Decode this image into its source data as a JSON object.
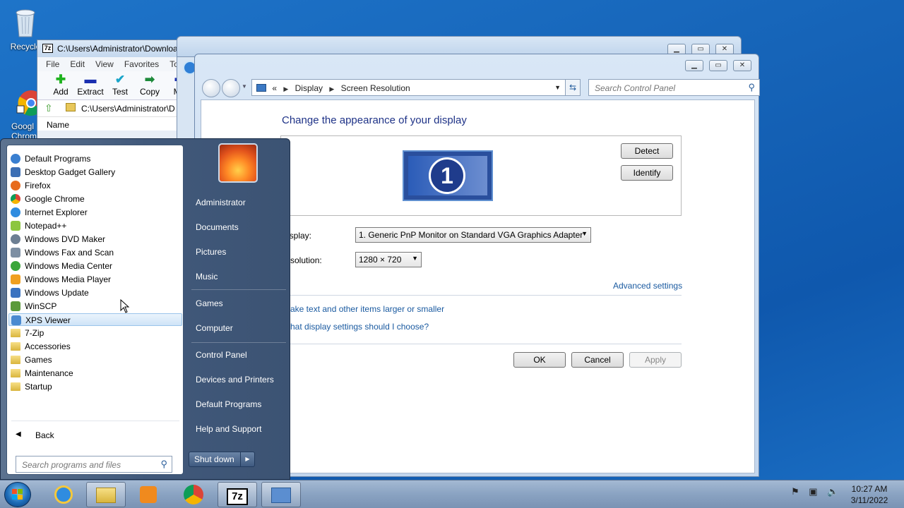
{
  "desktop": {
    "icons": [
      {
        "label": "Recycle"
      },
      {
        "label": "Googl\nChrom"
      }
    ]
  },
  "sevenzip": {
    "title": "C:\\Users\\Administrator\\Downloa",
    "menu": [
      "File",
      "Edit",
      "View",
      "Favorites",
      "Too"
    ],
    "toolbar": [
      "Add",
      "Extract",
      "Test",
      "Copy",
      "Mo"
    ],
    "address": "C:\\Users\\Administrator\\D",
    "column_header": "Name"
  },
  "control_panel": {
    "breadcrumb": {
      "root_sep": "«",
      "crumb1": "Display",
      "crumb2": "Screen Resolution"
    },
    "search_placeholder": "Search Control Panel",
    "heading": "Change the appearance of your display",
    "monitor_number": "1",
    "detect_label": "Detect",
    "identify_label": "Identify",
    "display_label": "isplay:",
    "display_value": "1. Generic PnP Monitor on Standard VGA Graphics Adapter",
    "resolution_label": "solution:",
    "resolution_value": "1280 × 720",
    "advanced_link": "Advanced settings",
    "link1": "ake text and other items larger or smaller",
    "link2": "hat display settings should I choose?",
    "ok_label": "OK",
    "cancel_label": "Cancel",
    "apply_label": "Apply"
  },
  "start_menu": {
    "programs": [
      {
        "label": "Default Programs",
        "color": "#3a7fd0"
      },
      {
        "label": "Desktop Gadget Gallery",
        "color": "#3d6fb4"
      },
      {
        "label": "Firefox",
        "color": "#e76b1e"
      },
      {
        "label": "Google Chrome",
        "color": "#4caf50"
      },
      {
        "label": "Internet Explorer",
        "color": "#2f8ce0"
      },
      {
        "label": "Notepad++",
        "color": "#8cc63f"
      },
      {
        "label": "Windows DVD Maker",
        "color": "#6d7f93"
      },
      {
        "label": "Windows Fax and Scan",
        "color": "#7d8fa3"
      },
      {
        "label": "Windows Media Center",
        "color": "#3aa63a"
      },
      {
        "label": "Windows Media Player",
        "color": "#f0a020"
      },
      {
        "label": "Windows Update",
        "color": "#3b73c0"
      },
      {
        "label": "WinSCP",
        "color": "#5a9a3a"
      },
      {
        "label": "XPS Viewer",
        "color": "#4a8ad0"
      }
    ],
    "folders": [
      "7-Zip",
      "Accessories",
      "Games",
      "Maintenance",
      "Startup"
    ],
    "highlighted": "XPS Viewer",
    "back_label": "Back",
    "search_placeholder": "Search programs and files",
    "right_items": [
      "Administrator",
      "Documents",
      "Pictures",
      "Music",
      "Games",
      "Computer",
      "Control Panel",
      "Devices and Printers",
      "Default Programs",
      "Help and Support"
    ],
    "shutdown_label": "Shut down"
  },
  "taskbar": {
    "time": "10:27 AM",
    "date": "3/11/2022",
    "sevenzip_label": "7z"
  }
}
